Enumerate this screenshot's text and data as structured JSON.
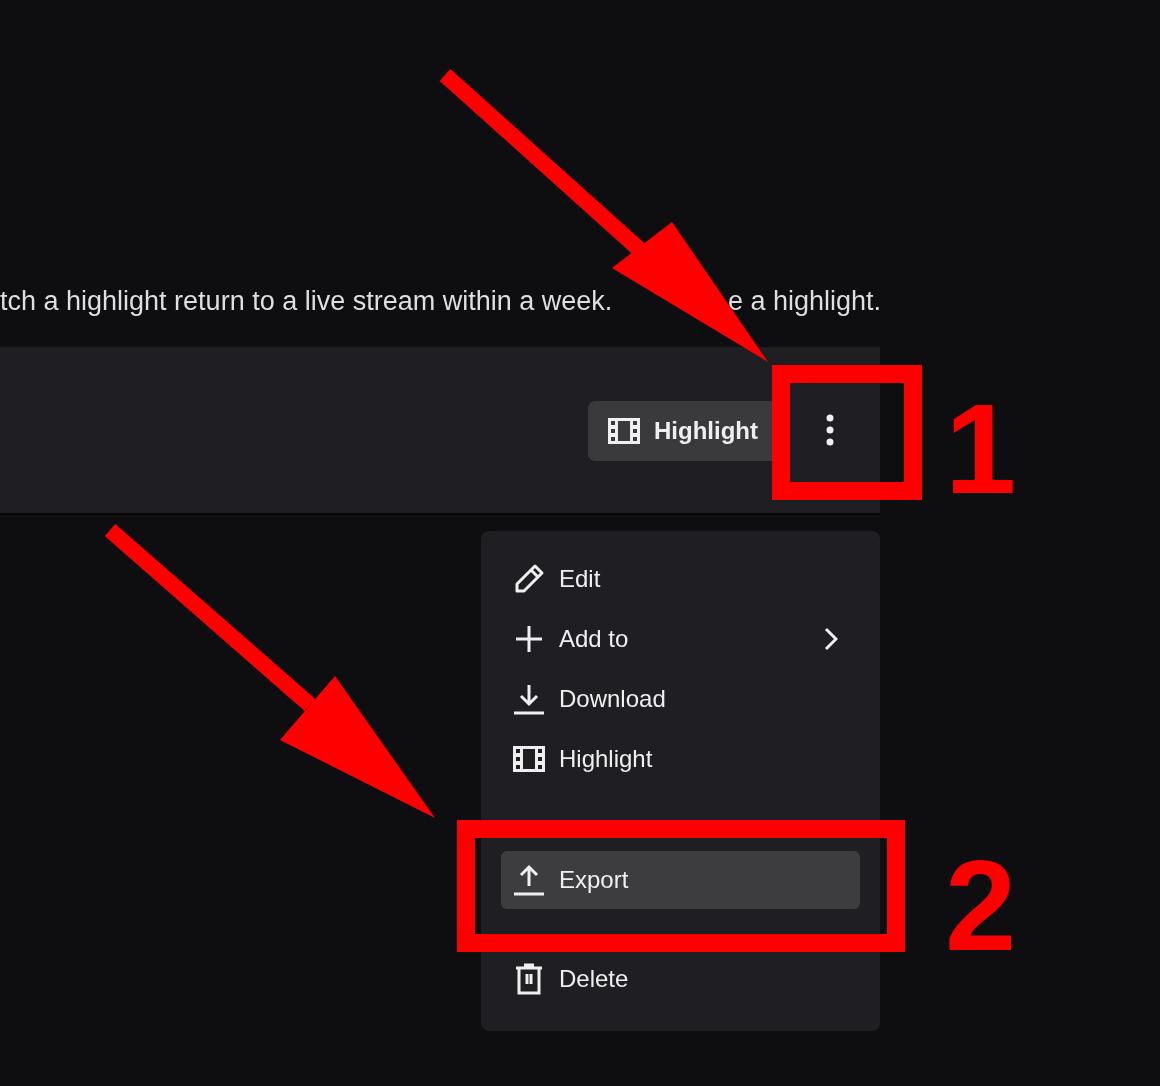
{
  "description": [
    {
      "text": "tch a highlight return to a live stream within a week."
    },
    {
      "text": "e a highlight."
    }
  ],
  "video_card": {
    "highlight_button": "Highlight"
  },
  "menu": [
    {
      "label": "Edit",
      "kind": "edit",
      "submenu": false,
      "selected": false
    },
    {
      "label": "Add to",
      "kind": "add",
      "submenu": true,
      "selected": false
    },
    {
      "label": "Download",
      "kind": "download",
      "submenu": false,
      "selected": false
    },
    {
      "label": "Highlight",
      "kind": "highlight",
      "submenu": false,
      "selected": false
    },
    {
      "label": "Export",
      "kind": "export",
      "submenu": false,
      "selected": true
    },
    {
      "label": "Delete",
      "kind": "delete",
      "submenu": false,
      "selected": false
    }
  ],
  "annotations": [
    {
      "label": "1"
    },
    {
      "label": "2"
    }
  ]
}
